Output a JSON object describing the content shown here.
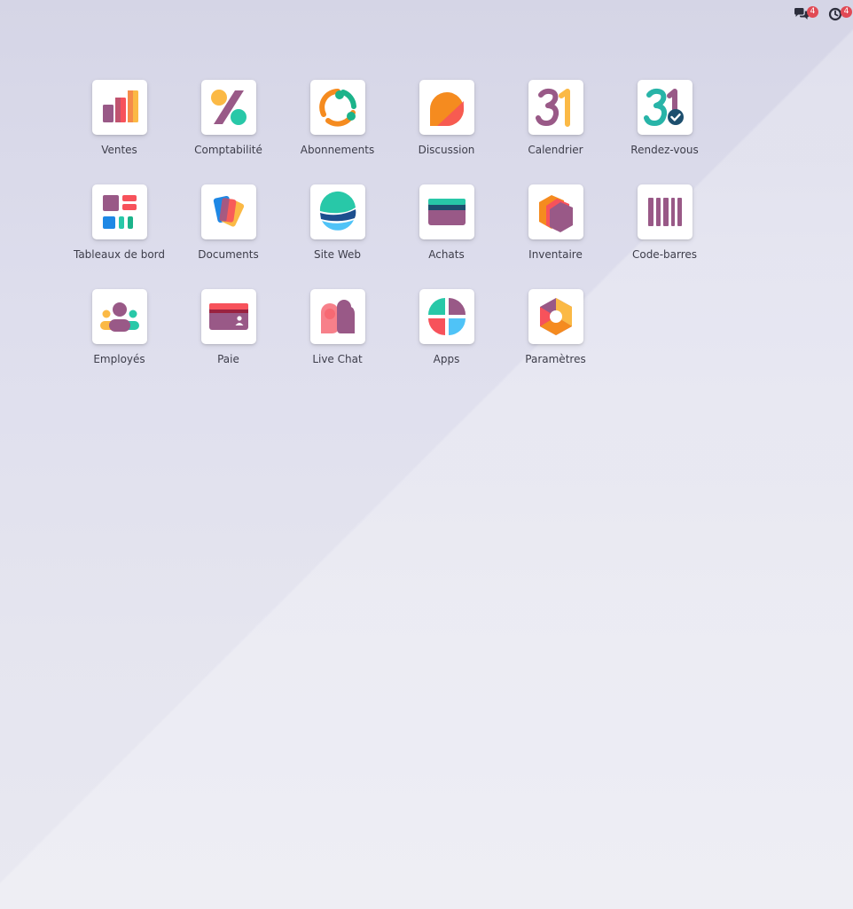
{
  "systray": {
    "messages": {
      "icon": "chat-bubbles-icon",
      "count": "4"
    },
    "activities": {
      "icon": "clock-icon",
      "count": "4"
    }
  },
  "apps": [
    {
      "label": "Ventes",
      "icon": "sales-bar-chart-icon"
    },
    {
      "label": "Comptabilité",
      "icon": "percent-icon"
    },
    {
      "label": "Abonnements",
      "icon": "subscription-cycle-icon"
    },
    {
      "label": "Discussion",
      "icon": "discussion-bubble-icon"
    },
    {
      "label": "Calendrier",
      "icon": "calendar-31-icon"
    },
    {
      "label": "Rendez-vous",
      "icon": "appointment-31-check-icon"
    },
    {
      "label": "Tableaux de bord",
      "icon": "dashboard-icon"
    },
    {
      "label": "Documents",
      "icon": "documents-icon"
    },
    {
      "label": "Site Web",
      "icon": "website-globe-icon"
    },
    {
      "label": "Achats",
      "icon": "credit-card-icon"
    },
    {
      "label": "Inventaire",
      "icon": "inventory-box-icon"
    },
    {
      "label": "Code-barres",
      "icon": "barcode-icon"
    },
    {
      "label": "Employés",
      "icon": "employees-icon"
    },
    {
      "label": "Paie",
      "icon": "payroll-card-icon"
    },
    {
      "label": "Live Chat",
      "icon": "live-chat-icon"
    },
    {
      "label": "Apps",
      "icon": "apps-quadrant-icon"
    },
    {
      "label": "Paramètres",
      "icon": "settings-hexagon-icon"
    }
  ]
}
